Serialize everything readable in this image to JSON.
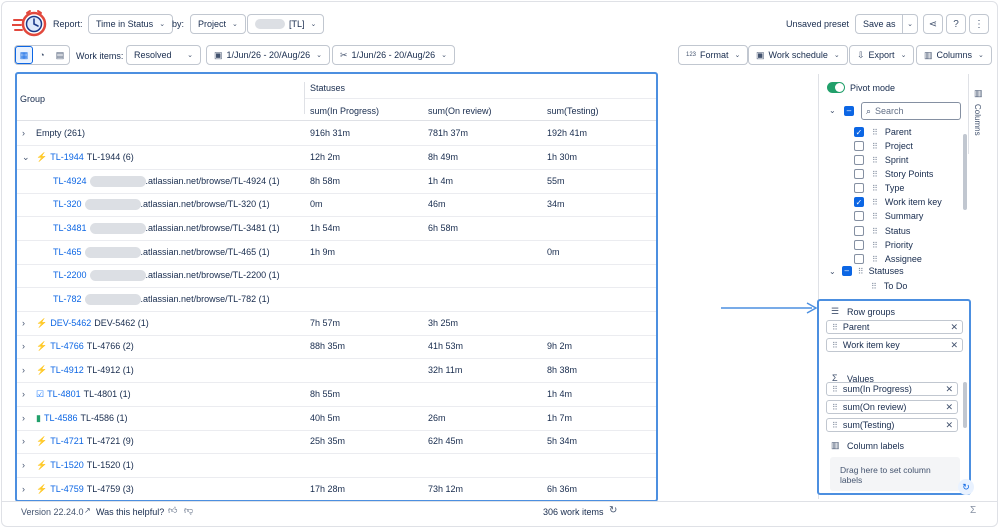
{
  "toolbar": {
    "report_label": "Report:",
    "report_value": "Time in Status",
    "by_label": "by:",
    "by_value": "Project",
    "project_value": "[TL]",
    "unsaved_preset": "Unsaved preset",
    "save_as": "Save as"
  },
  "toolbar2": {
    "work_items_label": "Work items:",
    "work_items_value": "Resolved",
    "date_range_1": "1/Jun/26 - 20/Aug/26",
    "date_range_2": "1/Jun/26 - 20/Aug/26",
    "format": "Format",
    "format_badge": "123",
    "work_schedule": "Work schedule",
    "export": "Export",
    "columns": "Columns"
  },
  "table": {
    "group_header": "Group",
    "statuses_header": "Statuses",
    "col1": "sum(In Progress)",
    "col2": "sum(On review)",
    "col3": "sum(Testing)",
    "rows": [
      {
        "caret": "›",
        "link": "",
        "text": "Empty (261)",
        "v1": "916h 31m",
        "v2": "781h 37m",
        "v3": "192h 41m"
      },
      {
        "caret": "⌄",
        "link": "TL-1944",
        "text": "TL-1944 (6)",
        "v1": "12h 2m",
        "v2": "8h 49m",
        "v3": "1h 30m"
      },
      {
        "link": "TL-4924",
        "text": ".atlassian.net/browse/TL-4924 (1)",
        "v1": "8h 58m",
        "v2": "1h 4m",
        "v3": "55m"
      },
      {
        "link": "TL-320",
        "text": ".atlassian.net/browse/TL-320 (1)",
        "v1": "0m",
        "v2": "46m",
        "v3": "34m"
      },
      {
        "link": "TL-3481",
        "text": ".atlassian.net/browse/TL-3481 (1)",
        "v1": "1h 54m",
        "v2": "6h 58m",
        "v3": ""
      },
      {
        "link": "TL-465",
        "text": ".atlassian.net/browse/TL-465 (1)",
        "v1": "1h 9m",
        "v2": "",
        "v3": "0m"
      },
      {
        "link": "TL-2200",
        "text": ".atlassian.net/browse/TL-2200 (1)",
        "v1": "",
        "v2": "",
        "v3": ""
      },
      {
        "link": "TL-782",
        "text": ".atlassian.net/browse/TL-782 (1)",
        "v1": "",
        "v2": "",
        "v3": ""
      },
      {
        "caret": "›",
        "link": "DEV-5462",
        "text": "DEV-5462 (1)",
        "v1": "7h 57m",
        "v2": "3h 25m",
        "v3": ""
      },
      {
        "caret": "›",
        "link": "TL-4766",
        "text": "TL-4766 (2)",
        "v1": "88h 35m",
        "v2": "41h 53m",
        "v3": "9h 2m"
      },
      {
        "caret": "›",
        "link": "TL-4912",
        "text": "TL-4912 (1)",
        "v1": "",
        "v2": "32h 11m",
        "v3": "8h 38m"
      },
      {
        "caret": "›",
        "link": "TL-4801",
        "text": "TL-4801 (1)",
        "v1": "8h 55m",
        "v2": "",
        "v3": "1h 4m"
      },
      {
        "caret": "›",
        "link": "TL-4586",
        "text": "TL-4586 (1)",
        "v1": "40h 5m",
        "v2": "26m",
        "v3": "1h 7m"
      },
      {
        "caret": "›",
        "link": "TL-4721",
        "text": "TL-4721 (9)",
        "v1": "25h 35m",
        "v2": "62h 45m",
        "v3": "5h 34m"
      },
      {
        "caret": "›",
        "link": "TL-1520",
        "text": "TL-1520 (1)",
        "v1": "",
        "v2": "",
        "v3": ""
      },
      {
        "caret": "›",
        "link": "TL-4759",
        "text": "TL-4759 (3)",
        "v1": "17h 28m",
        "v2": "73h 12m",
        "v3": "6h 36m"
      }
    ]
  },
  "panel": {
    "pivot_mode": "Pivot mode",
    "search_placeholder": "Search",
    "columns_tab": "Columns",
    "fields": [
      {
        "label": "Parent",
        "checked": true
      },
      {
        "label": "Project",
        "checked": false
      },
      {
        "label": "Sprint",
        "checked": false
      },
      {
        "label": "Story Points",
        "checked": false
      },
      {
        "label": "Type",
        "checked": false
      },
      {
        "label": "Work item key",
        "checked": true
      },
      {
        "label": "Summary",
        "checked": false
      },
      {
        "label": "Status",
        "checked": false
      },
      {
        "label": "Priority",
        "checked": false
      },
      {
        "label": "Assignee",
        "checked": false
      }
    ],
    "statuses_group": "Statuses",
    "status_to_do": "To Do",
    "row_groups_title": "Row groups",
    "row_groups": [
      "Parent",
      "Work item key"
    ],
    "values_title": "Values",
    "values": [
      "sum(In Progress)",
      "sum(On review)",
      "sum(Testing)"
    ],
    "column_labels_title": "Column labels",
    "drop_hint": "Drag here to set column labels"
  },
  "footer": {
    "version": "Version 22.24.0",
    "helpful": "Was this helpful?",
    "work_items_count": "306 work items",
    "sigma": "Σ"
  },
  "colors": {
    "accent": "#0c66e4",
    "highlight_border": "#4c8fe0",
    "toggle_green": "#22a06b"
  }
}
